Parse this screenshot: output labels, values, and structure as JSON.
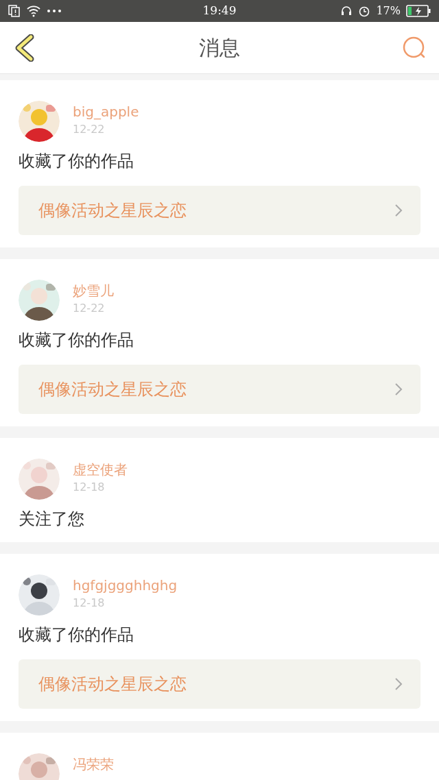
{
  "status_bar": {
    "time": "19:49",
    "battery": "17%"
  },
  "header": {
    "title": "消息"
  },
  "messages": [
    {
      "user": "big_apple",
      "date": "12-22",
      "action": "收藏了你的作品",
      "link": "偶像活动之星辰之恋"
    },
    {
      "user": "妙雪儿",
      "date": "12-22",
      "action": "收藏了你的作品",
      "link": "偶像活动之星辰之恋"
    },
    {
      "user": "虚空使者",
      "date": "12-18",
      "action": "关注了您"
    },
    {
      "user": "hgfgjggghhghg",
      "date": "12-18",
      "action": "收藏了你的作品",
      "link": "偶像活动之星辰之恋"
    },
    {
      "user": "冯荣荣"
    }
  ]
}
